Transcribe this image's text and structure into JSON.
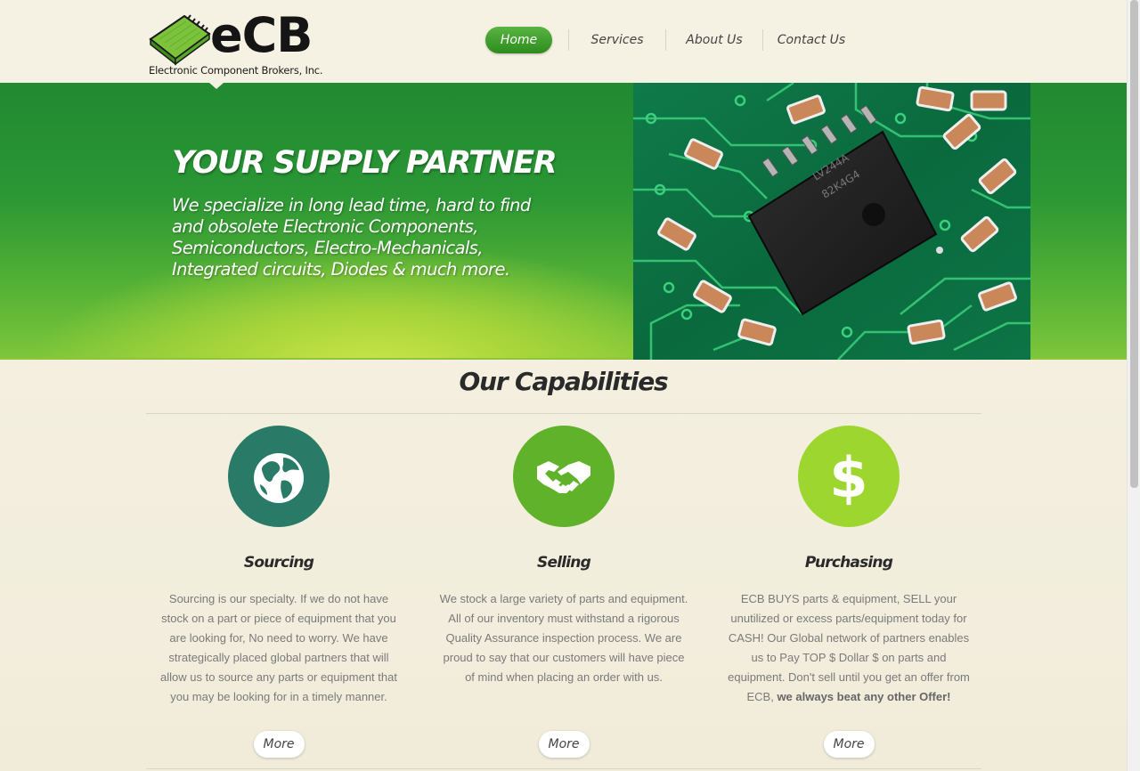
{
  "brand": {
    "logo_word": "eCB",
    "logo_sub": "Electronic Component Brokers, Inc."
  },
  "nav": {
    "items": [
      {
        "label": "Home",
        "active": true
      },
      {
        "label": "Services",
        "active": false
      },
      {
        "label": "About Us",
        "active": false
      },
      {
        "label": "Contact Us",
        "active": false
      }
    ]
  },
  "hero": {
    "title": "YOUR SUPPLY PARTNER",
    "text": "We specialize in long lead time, hard to find and obsolete Electronic Components, Semiconductors, Electro-Mechanicals, Integrated circuits, Diodes & much more.",
    "image_icon": "circuit-board-image"
  },
  "capabilities": {
    "title": "Our Capabilities",
    "items": [
      {
        "title": "Sourcing",
        "icon": "globe-icon",
        "color": "#2a7a68",
        "text": "Sourcing is our specialty. If we do not have stock on a part or piece of equipment that you are looking for, No need to worry. We have strategically placed global partners that will allow us to source any parts or equipment that you may be looking for in a timely manner.",
        "more": "More"
      },
      {
        "title": "Selling",
        "icon": "handshake-icon",
        "color": "#5fb22a",
        "text": "We stock a large variety of parts and equipment. All of our inventory must withstand a rigorous Quality Assurance inspection process. We are proud to say that our customers will have piece of mind when placing an order with us.",
        "more": "More"
      },
      {
        "title": "Purchasing",
        "icon": "dollar-icon",
        "color": "#9dd62f",
        "text": "ECB BUYS parts & equipment, SELL your unutilized or excess parts/equipment today for CASH! Our Global network of partners enables us to Pay TOP $ Dollar $ on parts and equipment. Don't sell until you get an offer from ECB,",
        "text_bold": "we always beat any other Offer!",
        "more": "More"
      }
    ]
  }
}
